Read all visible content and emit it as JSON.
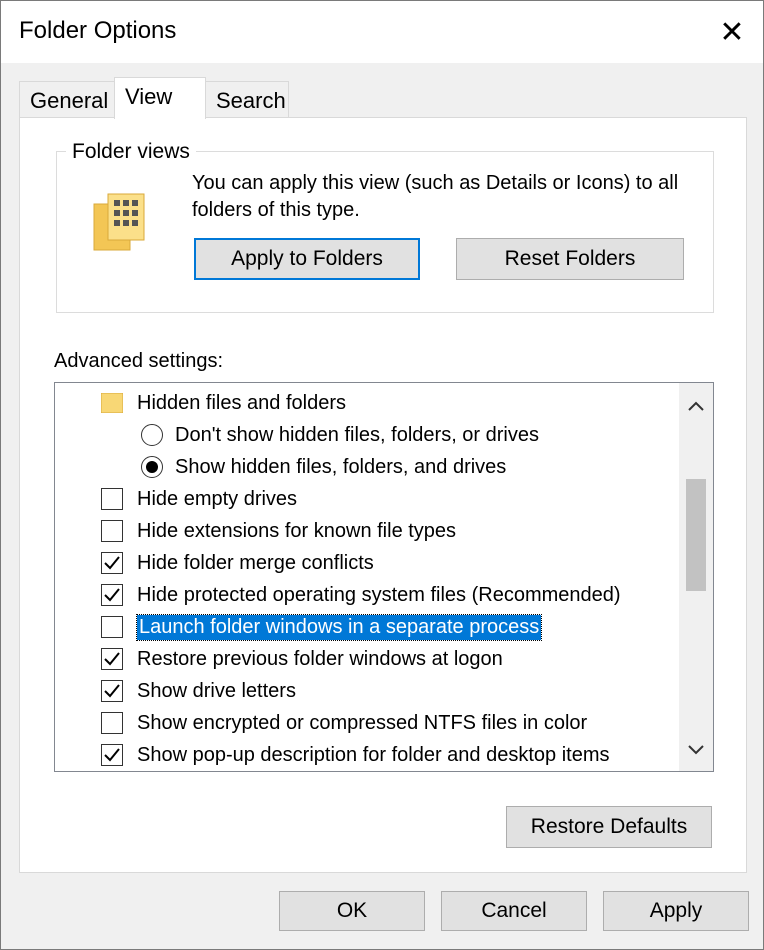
{
  "window": {
    "title": "Folder Options",
    "close_glyph": "✕"
  },
  "tabs": [
    {
      "label": "General",
      "active": false
    },
    {
      "label": "View",
      "active": true
    },
    {
      "label": "Search",
      "active": false
    }
  ],
  "folder_views": {
    "label": "Folder views",
    "description": "You can apply this view (such as Details or Icons) to all folders of this type.",
    "apply_button": "Apply to Folders",
    "reset_button": "Reset Folders"
  },
  "advanced": {
    "label": "Advanced settings:",
    "items": [
      {
        "type": "folder",
        "label": "Hidden files and folders"
      },
      {
        "type": "radio",
        "checked": false,
        "label": "Don't show hidden files, folders, or drives"
      },
      {
        "type": "radio",
        "checked": true,
        "label": "Show hidden files, folders, and drives"
      },
      {
        "type": "checkbox",
        "checked": false,
        "label": "Hide empty drives"
      },
      {
        "type": "checkbox",
        "checked": false,
        "label": "Hide extensions for known file types"
      },
      {
        "type": "checkbox",
        "checked": true,
        "label": "Hide folder merge conflicts"
      },
      {
        "type": "checkbox",
        "checked": true,
        "label": "Hide protected operating system files (Recommended)"
      },
      {
        "type": "checkbox",
        "checked": false,
        "label": "Launch folder windows in a separate process",
        "selected": true
      },
      {
        "type": "checkbox",
        "checked": true,
        "label": "Restore previous folder windows at logon"
      },
      {
        "type": "checkbox",
        "checked": true,
        "label": "Show drive letters"
      },
      {
        "type": "checkbox",
        "checked": false,
        "label": "Show encrypted or compressed NTFS files in color"
      },
      {
        "type": "checkbox",
        "checked": true,
        "label": "Show pop-up description for folder and desktop items"
      }
    ],
    "restore_defaults_button": "Restore Defaults"
  },
  "footer": {
    "ok": "OK",
    "cancel": "Cancel",
    "apply": "Apply"
  },
  "colors": {
    "accent": "#0078d7",
    "folder": "#f8d775"
  }
}
